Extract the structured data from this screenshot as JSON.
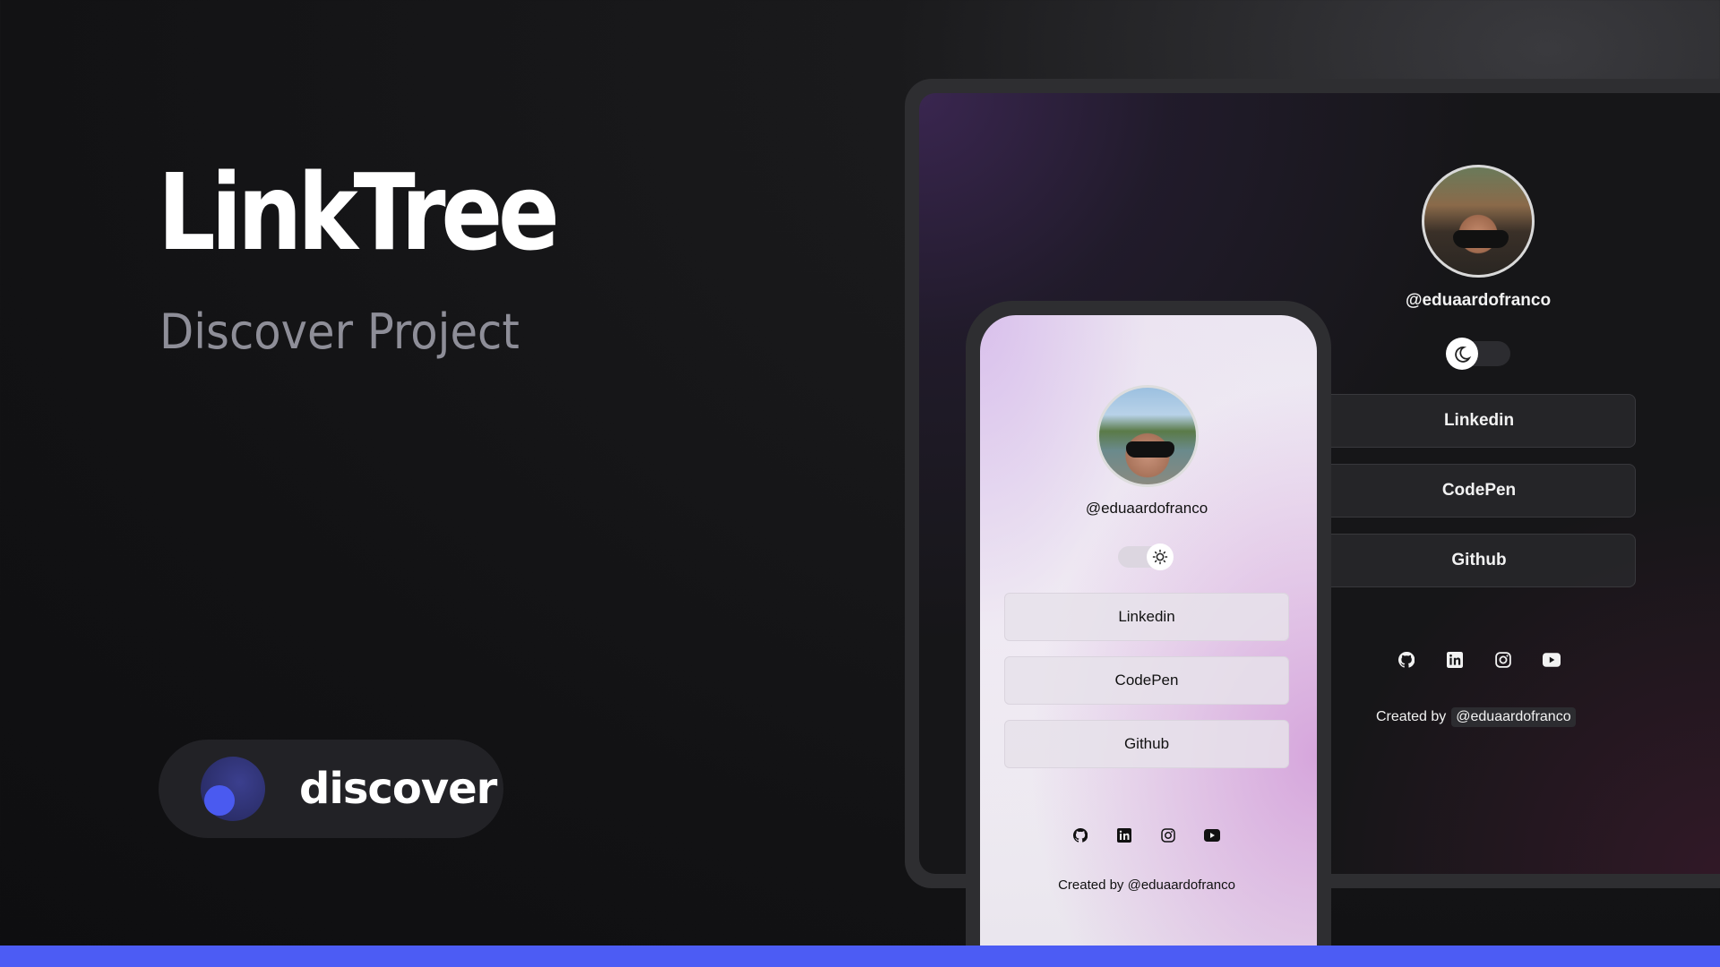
{
  "hero": {
    "title": "LinkTree",
    "subtitle": "Discover Project"
  },
  "badge": {
    "label": "discover",
    "accent_color": "#4c5cf4"
  },
  "desktop_preview": {
    "username": "@eduaardofranco",
    "theme_toggle_icon": "moon-icon",
    "links": [
      "Linkedin",
      "CodePen",
      "Github"
    ],
    "social_icons": [
      "github-icon",
      "linkedin-icon",
      "instagram-icon",
      "youtube-icon"
    ],
    "footer_prefix": "Created by",
    "footer_handle": "@eduaardofranco"
  },
  "phone_preview": {
    "username": "@eduaardofranco",
    "theme_toggle_icon": "sun-icon",
    "links": [
      "Linkedin",
      "CodePen",
      "Github"
    ],
    "social_icons": [
      "github-icon",
      "linkedin-icon",
      "instagram-icon",
      "youtube-icon"
    ],
    "footer_text": "Created by  @eduaardofranco"
  },
  "colors": {
    "background": "#121214",
    "bottom_bar": "#4c5cf4",
    "subtitle": "#8e8e98"
  }
}
